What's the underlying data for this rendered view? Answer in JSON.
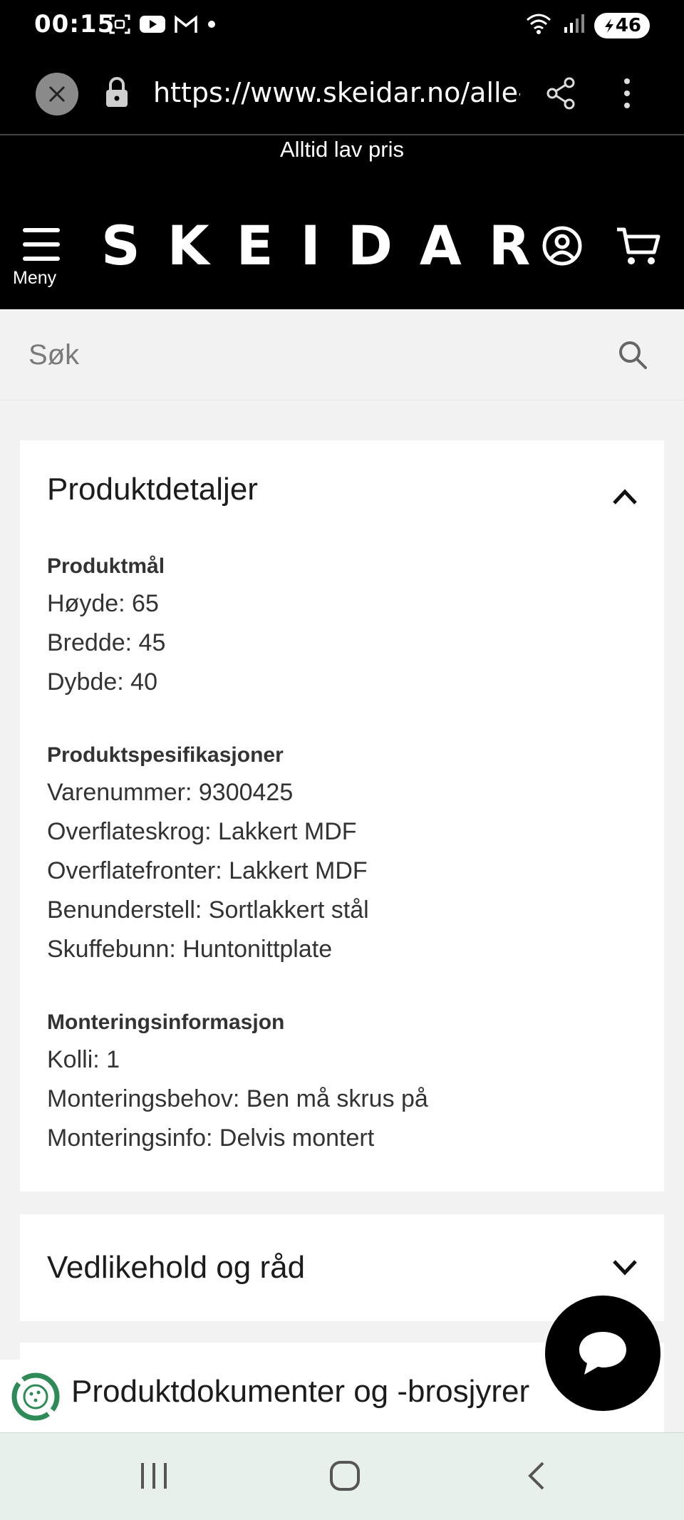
{
  "status_bar": {
    "time": "00:15",
    "battery": "46",
    "icons_left": [
      "screenshot-icon",
      "youtube-icon",
      "gmail-icon",
      "dot-icon"
    ],
    "icons_right": [
      "wifi-icon",
      "signal-icon",
      "battery-icon"
    ]
  },
  "browser": {
    "url": "https://www.skeidar.no/alle-p",
    "icons": [
      "close-icon",
      "lock-icon",
      "share-icon",
      "more-vert-icon"
    ]
  },
  "site": {
    "tagline": "Alltid lav pris",
    "menu_label": "Meny",
    "logo": "SKEIDAR"
  },
  "search": {
    "placeholder": "Søk"
  },
  "sections": {
    "product_details": {
      "title": "Produktdetaljer",
      "expanded": true,
      "groups": [
        {
          "heading": "Produktmål",
          "lines": [
            "Høyde: 65",
            "Bredde: 45",
            "Dybde: 40"
          ]
        },
        {
          "heading": "Produktspesifikasjoner",
          "lines": [
            "Varenummer: 9300425",
            "Overflateskrog: Lakkert MDF",
            "Overflatefronter: Lakkert MDF",
            "Benunderstell: Sortlakkert stål",
            "Skuffebunn: Huntonittplate"
          ]
        },
        {
          "heading": "Monteringsinformasjon",
          "lines": [
            "Kolli: 1",
            "Monteringsbehov: Ben må skrus på",
            "Monteringsinfo: Delvis montert"
          ]
        }
      ]
    },
    "maintenance": {
      "title": "Vedlikehold og råd",
      "expanded": false
    },
    "documents": {
      "title": "Produktdokumenter og -brosjyrer"
    }
  },
  "colors": {
    "header_bg": "#000000",
    "page_bg": "#f2f2f2",
    "card_bg": "#ffffff",
    "eco_green": "#2e8b57",
    "nav_bg": "#e8f0ec"
  }
}
